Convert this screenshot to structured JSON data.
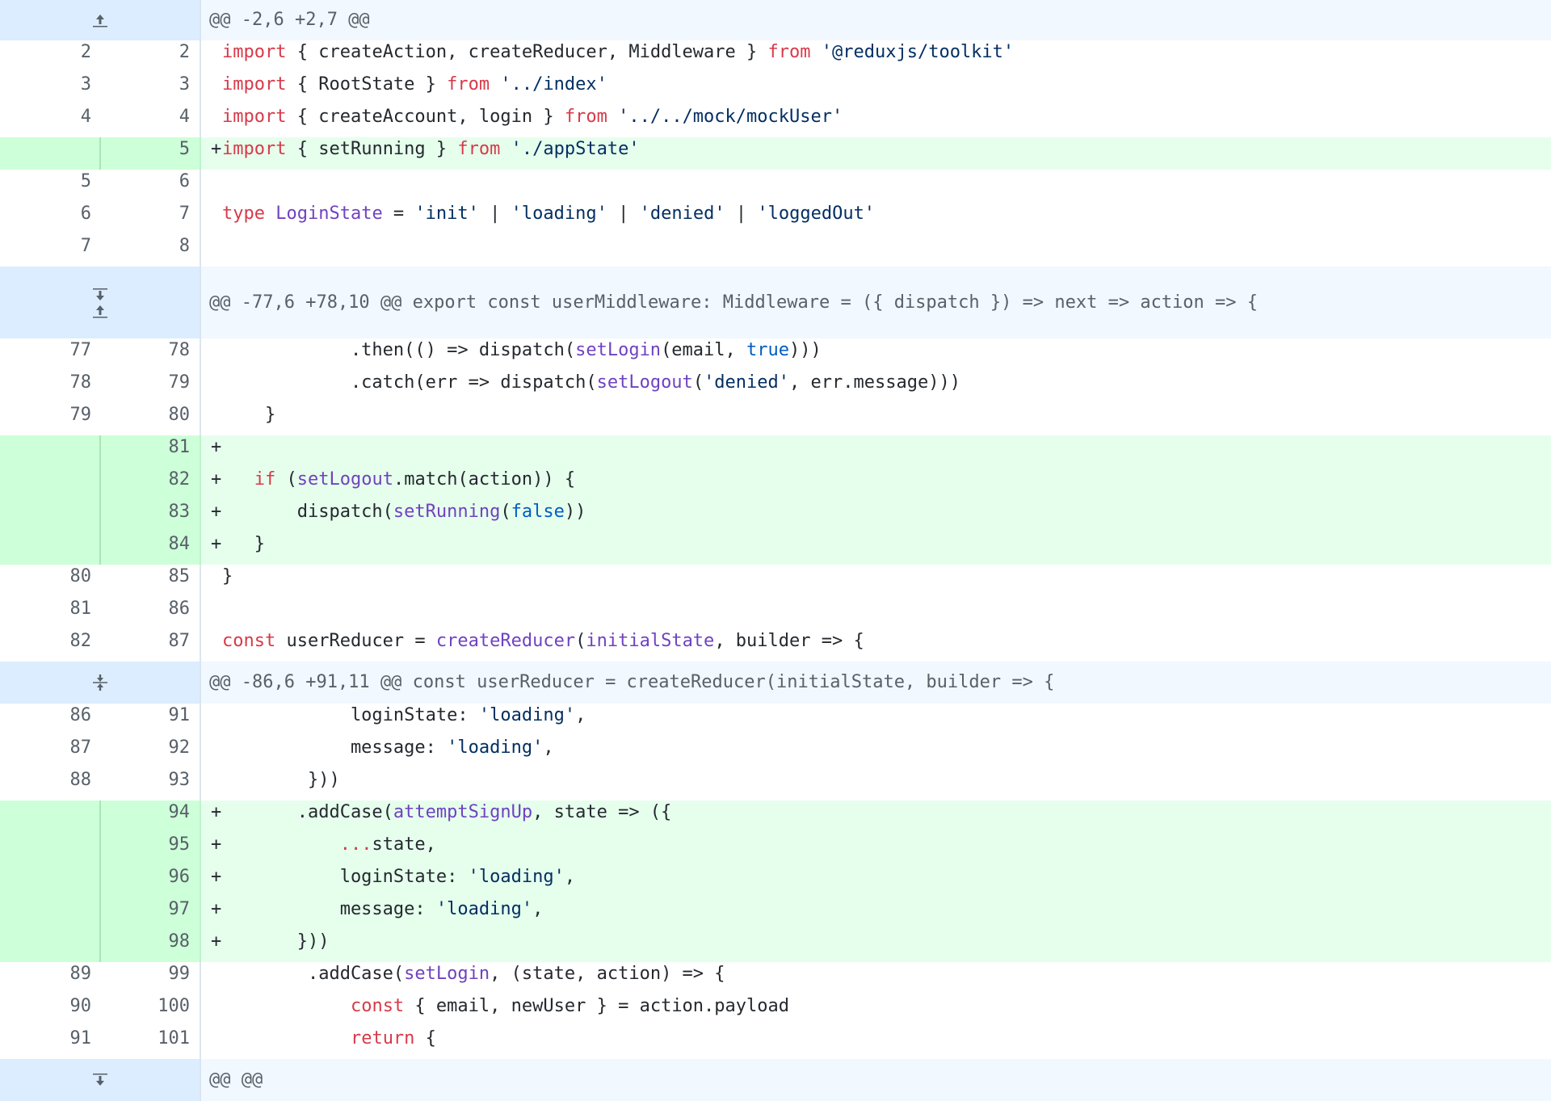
{
  "diff": {
    "rows": [
      {
        "type": "hunk",
        "cls": "h1",
        "header": "@@ -2,6 +2,7 @@",
        "icons": [
          "expand-up-icon"
        ]
      },
      {
        "type": "ctx",
        "old": "2",
        "new": "2",
        "tokens": [
          [
            "kw",
            "import"
          ],
          [
            "",
            " { createAction, createReducer, Middleware } "
          ],
          [
            "kw",
            "from"
          ],
          [
            "",
            " "
          ],
          [
            "str",
            "'@reduxjs/toolkit'"
          ]
        ]
      },
      {
        "type": "ctx",
        "old": "3",
        "new": "3",
        "tokens": [
          [
            "kw",
            "import"
          ],
          [
            "",
            " { RootState } "
          ],
          [
            "kw",
            "from"
          ],
          [
            "",
            " "
          ],
          [
            "str",
            "'../index'"
          ]
        ]
      },
      {
        "type": "ctx",
        "old": "4",
        "new": "4",
        "tokens": [
          [
            "kw",
            "import"
          ],
          [
            "",
            " { createAccount, login } "
          ],
          [
            "kw",
            "from"
          ],
          [
            "",
            " "
          ],
          [
            "str",
            "'../../mock/mockUser'"
          ]
        ]
      },
      {
        "type": "add",
        "old": "",
        "new": "5",
        "tokens": [
          [
            "kw",
            "import"
          ],
          [
            "",
            " { setRunning } "
          ],
          [
            "kw",
            "from"
          ],
          [
            "",
            " "
          ],
          [
            "str",
            "'./appState'"
          ]
        ]
      },
      {
        "type": "ctx",
        "old": "5",
        "new": "6",
        "tokens": []
      },
      {
        "type": "ctx",
        "old": "6",
        "new": "7",
        "tokens": [
          [
            "kw",
            "type"
          ],
          [
            "",
            " "
          ],
          [
            "fn",
            "LoginState"
          ],
          [
            "",
            " = "
          ],
          [
            "str",
            "'init'"
          ],
          [
            "",
            " | "
          ],
          [
            "str",
            "'loading'"
          ],
          [
            "",
            " | "
          ],
          [
            "str",
            "'denied'"
          ],
          [
            "",
            " | "
          ],
          [
            "str",
            "'loggedOut'"
          ]
        ]
      },
      {
        "type": "ctx",
        "old": "7",
        "new": "8",
        "tokens": []
      },
      {
        "type": "hunk",
        "cls": "h2",
        "header": "@@ -77,6 +78,10 @@ export const userMiddleware: Middleware = ({ dispatch }) => next => action => {",
        "icons": [
          "expand-down-icon",
          "expand-up-icon"
        ]
      },
      {
        "type": "ctx",
        "old": "77",
        "new": "78",
        "tokens": [
          [
            "",
            "            .then(() => dispatch("
          ],
          [
            "fn",
            "setLogin"
          ],
          [
            "",
            "(email, "
          ],
          [
            "const",
            "true"
          ],
          [
            "",
            ")))"
          ]
        ]
      },
      {
        "type": "ctx",
        "old": "78",
        "new": "79",
        "tokens": [
          [
            "",
            "            .catch(err => dispatch("
          ],
          [
            "fn",
            "setLogout"
          ],
          [
            "",
            "("
          ],
          [
            "str",
            "'denied'"
          ],
          [
            "",
            ", err.message)))"
          ]
        ]
      },
      {
        "type": "ctx",
        "old": "79",
        "new": "80",
        "tokens": [
          [
            "",
            "    }"
          ]
        ]
      },
      {
        "type": "add",
        "old": "",
        "new": "81",
        "tokens": []
      },
      {
        "type": "add",
        "old": "",
        "new": "82",
        "tokens": [
          [
            "",
            "   "
          ],
          [
            "kw",
            "if"
          ],
          [
            "",
            " ("
          ],
          [
            "fn",
            "setLogout"
          ],
          [
            "",
            ".match(action)) {"
          ]
        ]
      },
      {
        "type": "add",
        "old": "",
        "new": "83",
        "tokens": [
          [
            "",
            "       dispatch("
          ],
          [
            "fn",
            "setRunning"
          ],
          [
            "",
            "("
          ],
          [
            "const",
            "false"
          ],
          [
            "",
            "))"
          ]
        ]
      },
      {
        "type": "add",
        "old": "",
        "new": "84",
        "tokens": [
          [
            "",
            "   }"
          ]
        ]
      },
      {
        "type": "ctx",
        "old": "80",
        "new": "85",
        "tokens": [
          [
            "",
            "}"
          ]
        ]
      },
      {
        "type": "ctx",
        "old": "81",
        "new": "86",
        "tokens": []
      },
      {
        "type": "ctx",
        "old": "82",
        "new": "87",
        "tokens": [
          [
            "kw",
            "const"
          ],
          [
            "",
            " userReducer = "
          ],
          [
            "fn",
            "createReducer"
          ],
          [
            "",
            "("
          ],
          [
            "fn",
            "initialState"
          ],
          [
            "",
            ", builder => {"
          ]
        ]
      },
      {
        "type": "hunk",
        "cls": "h3",
        "header": "@@ -86,6 +91,11 @@ const userReducer = createReducer(initialState, builder => {",
        "icons": [
          "collapse-icon"
        ]
      },
      {
        "type": "ctx",
        "old": "86",
        "new": "91",
        "tokens": [
          [
            "",
            "            loginState: "
          ],
          [
            "str",
            "'loading'"
          ],
          [
            "",
            ","
          ]
        ]
      },
      {
        "type": "ctx",
        "old": "87",
        "new": "92",
        "tokens": [
          [
            "",
            "            message: "
          ],
          [
            "str",
            "'loading'"
          ],
          [
            "",
            ","
          ]
        ]
      },
      {
        "type": "ctx",
        "old": "88",
        "new": "93",
        "tokens": [
          [
            "",
            "        }))"
          ]
        ]
      },
      {
        "type": "add",
        "old": "",
        "new": "94",
        "tokens": [
          [
            "",
            "       .addCase("
          ],
          [
            "fn",
            "attemptSignUp"
          ],
          [
            "",
            ", state => ({"
          ]
        ]
      },
      {
        "type": "add",
        "old": "",
        "new": "95",
        "tokens": [
          [
            "",
            "           "
          ],
          [
            "kw",
            "..."
          ],
          [
            "",
            "state,"
          ]
        ]
      },
      {
        "type": "add",
        "old": "",
        "new": "96",
        "tokens": [
          [
            "",
            "           loginState: "
          ],
          [
            "str",
            "'loading'"
          ],
          [
            "",
            ","
          ]
        ]
      },
      {
        "type": "add",
        "old": "",
        "new": "97",
        "tokens": [
          [
            "",
            "           message: "
          ],
          [
            "str",
            "'loading'"
          ],
          [
            "",
            ","
          ]
        ]
      },
      {
        "type": "add",
        "old": "",
        "new": "98",
        "tokens": [
          [
            "",
            "       }))"
          ]
        ]
      },
      {
        "type": "ctx",
        "old": "89",
        "new": "99",
        "tokens": [
          [
            "",
            "        .addCase("
          ],
          [
            "fn",
            "setLogin"
          ],
          [
            "",
            ", (state, action) => {"
          ]
        ]
      },
      {
        "type": "ctx",
        "old": "90",
        "new": "100",
        "tokens": [
          [
            "",
            "            "
          ],
          [
            "kw",
            "const"
          ],
          [
            "",
            " { email, newUser } = action.payload"
          ]
        ]
      },
      {
        "type": "ctx",
        "old": "91",
        "new": "101",
        "tokens": [
          [
            "",
            "            "
          ],
          [
            "kw",
            "return"
          ],
          [
            "",
            " {"
          ]
        ]
      },
      {
        "type": "hunk",
        "cls": "h4",
        "header": "@@ @@",
        "icons": [
          "expand-down-icon"
        ]
      }
    ],
    "add_marker": "+"
  }
}
